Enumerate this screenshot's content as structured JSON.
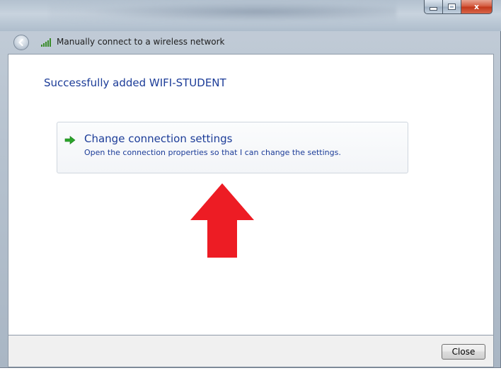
{
  "window": {
    "nav_title": "Manually connect to a wireless network",
    "caption_buttons": {
      "close_glyph": "x"
    }
  },
  "content": {
    "heading": "Successfully added WIFI-STUDENT",
    "command_link": {
      "title": "Change connection settings",
      "description": "Open the connection properties so that I can change the settings.",
      "icon": "green-arrow-icon"
    },
    "annotation": {
      "icon": "red-arrow-icon",
      "color": "#ed1c24"
    }
  },
  "footer": {
    "close_label": "Close"
  },
  "colors": {
    "link_blue": "#1c3c98",
    "arrow_green": "#2aa52a",
    "annotation_red": "#ed1c24"
  }
}
